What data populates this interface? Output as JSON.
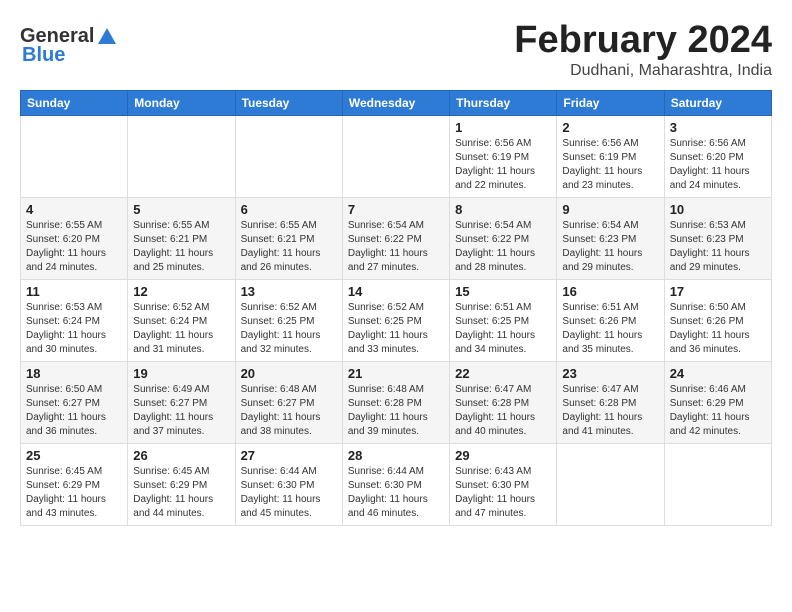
{
  "logo": {
    "general": "General",
    "blue": "Blue"
  },
  "title": {
    "month": "February 2024",
    "location": "Dudhani, Maharashtra, India"
  },
  "headers": [
    "Sunday",
    "Monday",
    "Tuesday",
    "Wednesday",
    "Thursday",
    "Friday",
    "Saturday"
  ],
  "weeks": [
    [
      {
        "day": "",
        "info": ""
      },
      {
        "day": "",
        "info": ""
      },
      {
        "day": "",
        "info": ""
      },
      {
        "day": "",
        "info": ""
      },
      {
        "day": "1",
        "info": "Sunrise: 6:56 AM\nSunset: 6:19 PM\nDaylight: 11 hours\nand 22 minutes."
      },
      {
        "day": "2",
        "info": "Sunrise: 6:56 AM\nSunset: 6:19 PM\nDaylight: 11 hours\nand 23 minutes."
      },
      {
        "day": "3",
        "info": "Sunrise: 6:56 AM\nSunset: 6:20 PM\nDaylight: 11 hours\nand 24 minutes."
      }
    ],
    [
      {
        "day": "4",
        "info": "Sunrise: 6:55 AM\nSunset: 6:20 PM\nDaylight: 11 hours\nand 24 minutes."
      },
      {
        "day": "5",
        "info": "Sunrise: 6:55 AM\nSunset: 6:21 PM\nDaylight: 11 hours\nand 25 minutes."
      },
      {
        "day": "6",
        "info": "Sunrise: 6:55 AM\nSunset: 6:21 PM\nDaylight: 11 hours\nand 26 minutes."
      },
      {
        "day": "7",
        "info": "Sunrise: 6:54 AM\nSunset: 6:22 PM\nDaylight: 11 hours\nand 27 minutes."
      },
      {
        "day": "8",
        "info": "Sunrise: 6:54 AM\nSunset: 6:22 PM\nDaylight: 11 hours\nand 28 minutes."
      },
      {
        "day": "9",
        "info": "Sunrise: 6:54 AM\nSunset: 6:23 PM\nDaylight: 11 hours\nand 29 minutes."
      },
      {
        "day": "10",
        "info": "Sunrise: 6:53 AM\nSunset: 6:23 PM\nDaylight: 11 hours\nand 29 minutes."
      }
    ],
    [
      {
        "day": "11",
        "info": "Sunrise: 6:53 AM\nSunset: 6:24 PM\nDaylight: 11 hours\nand 30 minutes."
      },
      {
        "day": "12",
        "info": "Sunrise: 6:52 AM\nSunset: 6:24 PM\nDaylight: 11 hours\nand 31 minutes."
      },
      {
        "day": "13",
        "info": "Sunrise: 6:52 AM\nSunset: 6:25 PM\nDaylight: 11 hours\nand 32 minutes."
      },
      {
        "day": "14",
        "info": "Sunrise: 6:52 AM\nSunset: 6:25 PM\nDaylight: 11 hours\nand 33 minutes."
      },
      {
        "day": "15",
        "info": "Sunrise: 6:51 AM\nSunset: 6:25 PM\nDaylight: 11 hours\nand 34 minutes."
      },
      {
        "day": "16",
        "info": "Sunrise: 6:51 AM\nSunset: 6:26 PM\nDaylight: 11 hours\nand 35 minutes."
      },
      {
        "day": "17",
        "info": "Sunrise: 6:50 AM\nSunset: 6:26 PM\nDaylight: 11 hours\nand 36 minutes."
      }
    ],
    [
      {
        "day": "18",
        "info": "Sunrise: 6:50 AM\nSunset: 6:27 PM\nDaylight: 11 hours\nand 36 minutes."
      },
      {
        "day": "19",
        "info": "Sunrise: 6:49 AM\nSunset: 6:27 PM\nDaylight: 11 hours\nand 37 minutes."
      },
      {
        "day": "20",
        "info": "Sunrise: 6:48 AM\nSunset: 6:27 PM\nDaylight: 11 hours\nand 38 minutes."
      },
      {
        "day": "21",
        "info": "Sunrise: 6:48 AM\nSunset: 6:28 PM\nDaylight: 11 hours\nand 39 minutes."
      },
      {
        "day": "22",
        "info": "Sunrise: 6:47 AM\nSunset: 6:28 PM\nDaylight: 11 hours\nand 40 minutes."
      },
      {
        "day": "23",
        "info": "Sunrise: 6:47 AM\nSunset: 6:28 PM\nDaylight: 11 hours\nand 41 minutes."
      },
      {
        "day": "24",
        "info": "Sunrise: 6:46 AM\nSunset: 6:29 PM\nDaylight: 11 hours\nand 42 minutes."
      }
    ],
    [
      {
        "day": "25",
        "info": "Sunrise: 6:45 AM\nSunset: 6:29 PM\nDaylight: 11 hours\nand 43 minutes."
      },
      {
        "day": "26",
        "info": "Sunrise: 6:45 AM\nSunset: 6:29 PM\nDaylight: 11 hours\nand 44 minutes."
      },
      {
        "day": "27",
        "info": "Sunrise: 6:44 AM\nSunset: 6:30 PM\nDaylight: 11 hours\nand 45 minutes."
      },
      {
        "day": "28",
        "info": "Sunrise: 6:44 AM\nSunset: 6:30 PM\nDaylight: 11 hours\nand 46 minutes."
      },
      {
        "day": "29",
        "info": "Sunrise: 6:43 AM\nSunset: 6:30 PM\nDaylight: 11 hours\nand 47 minutes."
      },
      {
        "day": "",
        "info": ""
      },
      {
        "day": "",
        "info": ""
      }
    ]
  ]
}
